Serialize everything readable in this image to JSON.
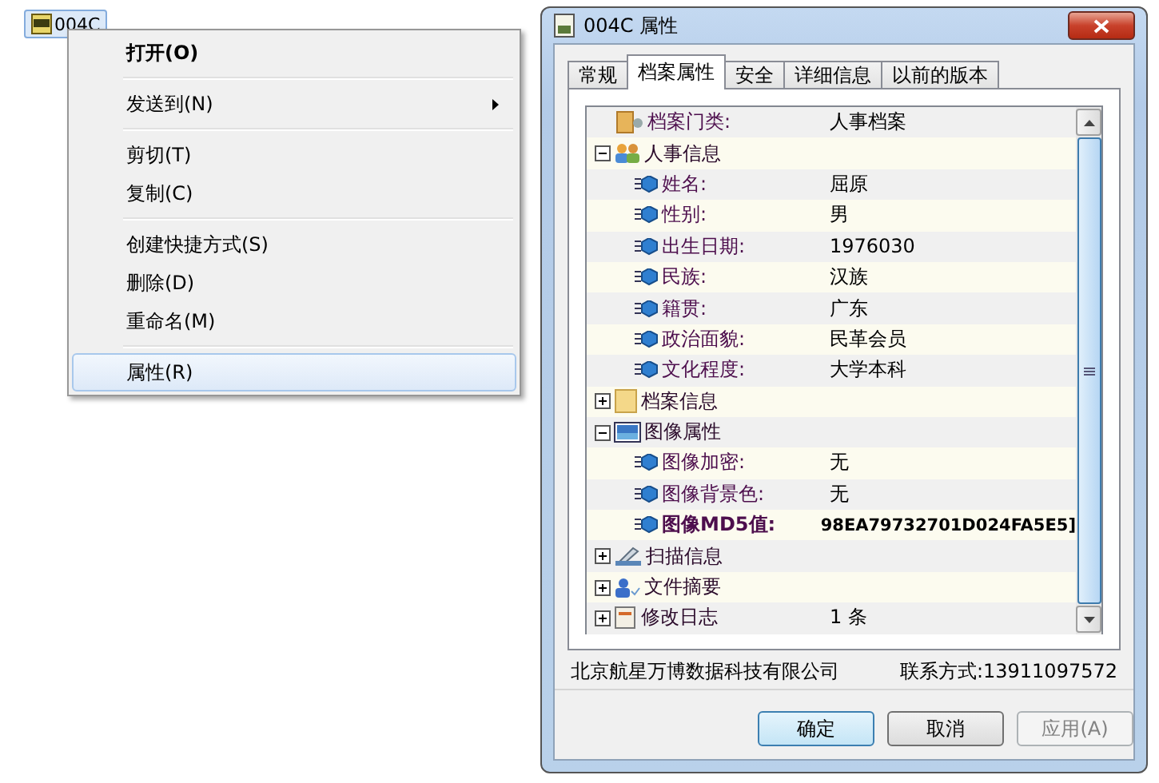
{
  "desktop_icon": {
    "label": "004C",
    "selected": true
  },
  "context_menu": {
    "sections": [
      [
        {
          "label": "打开(O)",
          "default": true,
          "submenu": false,
          "selected": false
        }
      ],
      [
        {
          "label": "发送到(N)",
          "default": false,
          "submenu": true,
          "selected": false
        }
      ],
      [
        {
          "label": "剪切(T)",
          "default": false,
          "submenu": false,
          "selected": false
        },
        {
          "label": "复制(C)",
          "default": false,
          "submenu": false,
          "selected": false
        }
      ],
      [
        {
          "label": "创建快捷方式(S)",
          "default": false,
          "submenu": false,
          "selected": false
        },
        {
          "label": "删除(D)",
          "default": false,
          "submenu": false,
          "selected": false
        },
        {
          "label": "重命名(M)",
          "default": false,
          "submenu": false,
          "selected": false
        }
      ],
      [
        {
          "label": "属性(R)",
          "default": false,
          "submenu": false,
          "selected": true
        }
      ]
    ]
  },
  "window": {
    "title": "004C 属性"
  },
  "tabs": [
    {
      "label": "常规",
      "selected": false
    },
    {
      "label": "档案属性",
      "selected": true
    },
    {
      "label": "安全",
      "selected": false
    },
    {
      "label": "详细信息",
      "selected": false
    },
    {
      "label": "以前的版本",
      "selected": false
    }
  ],
  "tree": [
    {
      "kind": "property",
      "label": "档案门类:",
      "value": "人事档案",
      "bold": false
    },
    {
      "kind": "group",
      "label": "人事信息",
      "expanded": true,
      "children": [
        {
          "kind": "field",
          "label": "姓名:",
          "value": "屈原",
          "bold": false
        },
        {
          "kind": "field",
          "label": "性别:",
          "value": "男",
          "bold": false
        },
        {
          "kind": "field",
          "label": "出生日期:",
          "value": "1976030",
          "bold": false
        },
        {
          "kind": "field",
          "label": "民族:",
          "value": "汉族",
          "bold": false
        },
        {
          "kind": "field",
          "label": "籍贯:",
          "value": "广东",
          "bold": false
        },
        {
          "kind": "field",
          "label": "政治面貌:",
          "value": "民革会员",
          "bold": false
        },
        {
          "kind": "field",
          "label": "文化程度:",
          "value": "大学本科",
          "bold": false
        }
      ]
    },
    {
      "kind": "group",
      "label": "档案信息",
      "expanded": false
    },
    {
      "kind": "group",
      "label": "图像属性",
      "expanded": true,
      "children": [
        {
          "kind": "field",
          "label": "图像加密:",
          "value": "无",
          "bold": false
        },
        {
          "kind": "field",
          "label": "图像背景色:",
          "value": "无",
          "bold": false
        },
        {
          "kind": "field",
          "label": "图像MD5值:",
          "value": "98EA79732701D024FA5E5]",
          "bold": true
        }
      ]
    },
    {
      "kind": "group",
      "label": "扫描信息",
      "expanded": false
    },
    {
      "kind": "group",
      "label": "文件摘要",
      "expanded": false
    },
    {
      "kind": "group",
      "label": "修改日志",
      "expanded": false,
      "value": "1 条"
    }
  ],
  "footer": {
    "company": "北京航星万博数据科技有限公司",
    "contact": "联系方式:13911097572"
  },
  "buttons": [
    {
      "label": "确定",
      "default": true,
      "disabled": false
    },
    {
      "label": "取消",
      "default": false,
      "disabled": false
    },
    {
      "label": "应用(A)",
      "default": false,
      "disabled": true
    }
  ]
}
